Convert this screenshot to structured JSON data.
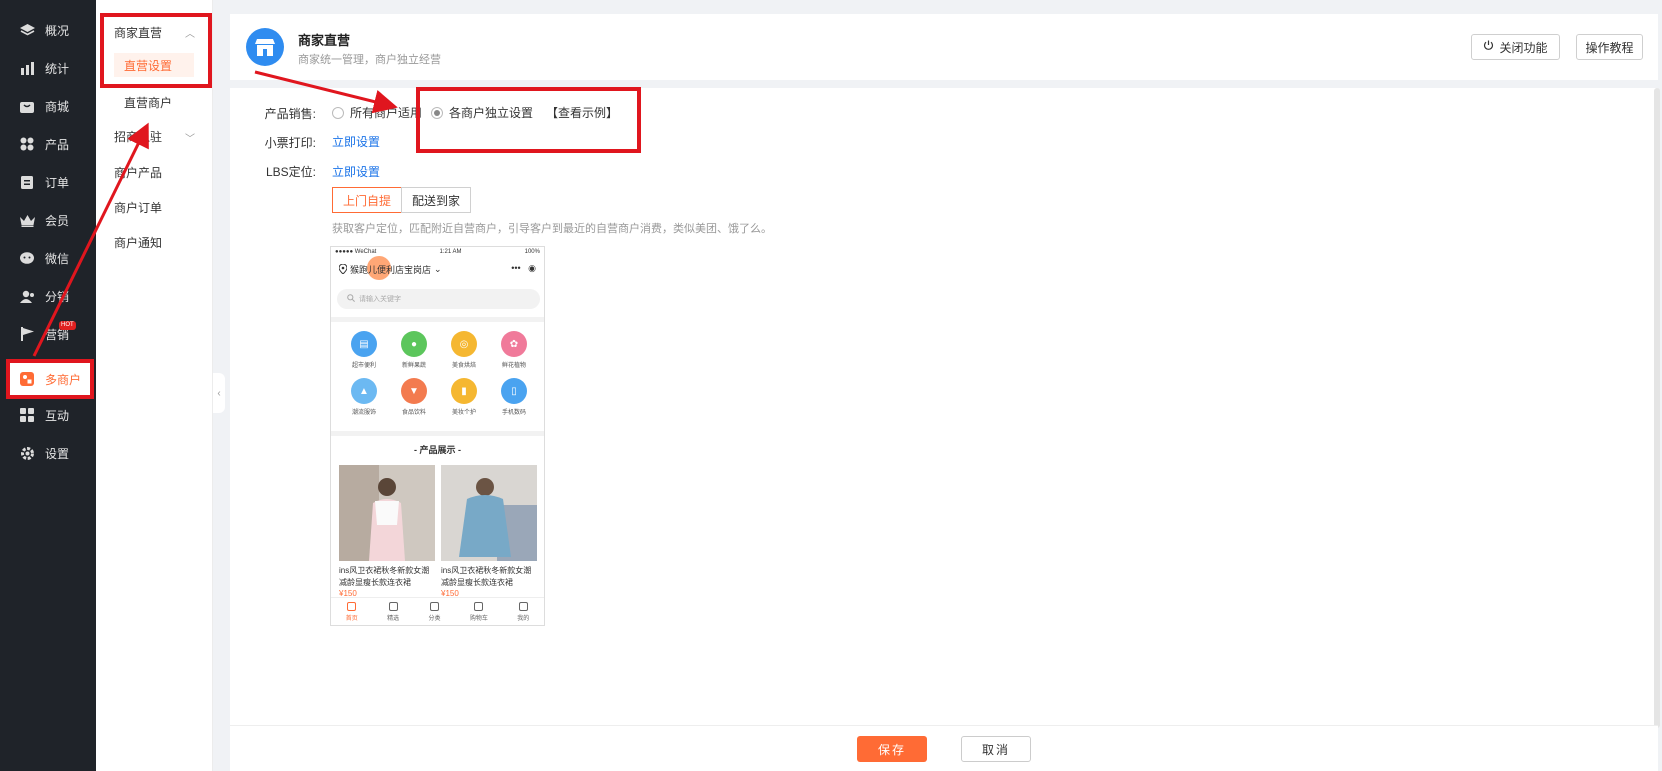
{
  "nav": {
    "items": [
      {
        "label": "概况",
        "icon": "layers-icon"
      },
      {
        "label": "统计",
        "icon": "chart-icon"
      },
      {
        "label": "商城",
        "icon": "shop-icon"
      },
      {
        "label": "产品",
        "icon": "grid-icon"
      },
      {
        "label": "订单",
        "icon": "order-icon"
      },
      {
        "label": "会员",
        "icon": "crown-icon"
      },
      {
        "label": "微信",
        "icon": "wechat-icon"
      },
      {
        "label": "分销",
        "icon": "users-icon"
      },
      {
        "label": "营销",
        "icon": "flag-icon",
        "badge": "HOT"
      },
      {
        "label": "多商户",
        "icon": "merchant-icon"
      },
      {
        "label": "互动",
        "icon": "interact-icon"
      },
      {
        "label": "设置",
        "icon": "gear-icon"
      }
    ],
    "active": "多商户"
  },
  "subnav": {
    "group1": "商家直营",
    "group1_items": [
      "直营设置",
      "直营商户"
    ],
    "group2": "招商入驻",
    "group2_items": [
      "商户产品",
      "商户订单",
      "商户通知"
    ]
  },
  "header": {
    "title": "商家直营",
    "subtitle": "商家统一管理，商户独立经营",
    "close_btn": "关闭功能",
    "tutorial_btn": "操作教程"
  },
  "form": {
    "sales_label": "产品销售:",
    "option_all": "所有商户适用",
    "option_each": "各商户独立设置",
    "view_example": "【查看示例】",
    "print_label": "小票打印:",
    "print_link": "立即设置",
    "lbs_label": "LBS定位:",
    "lbs_link": "立即设置",
    "tab_pickup": "上门自提",
    "tab_delivery": "配送到家",
    "hint": "获取客户定位，匹配附近自营商户，引导客户到最近的自营商户消费，类似美团、饿了么。"
  },
  "phone": {
    "carrier": "●●●●● WeChat",
    "time": "1:21 AM",
    "battery": "100%",
    "location": "猴跑儿便利店宝岗店",
    "search_placeholder": "请输入关键字",
    "categories": [
      {
        "label": "超市便利",
        "color": "#4aa3f0"
      },
      {
        "label": "新鲜果蔬",
        "color": "#5cc65c"
      },
      {
        "label": "美食烘焙",
        "color": "#f5b731"
      },
      {
        "label": "鲜花植物",
        "color": "#f07a9a"
      },
      {
        "label": "潮流服饰",
        "color": "#6cb9f2"
      },
      {
        "label": "食品饮料",
        "color": "#f37b4f"
      },
      {
        "label": "美妆个护",
        "color": "#f5b731"
      },
      {
        "label": "手机数码",
        "color": "#4aa3f0"
      }
    ],
    "section_title": "- 产品展示 -",
    "products": [
      {
        "name": "ins风卫衣裙秋冬新款女潮减龄显瘦长款连衣裙",
        "price": "¥150"
      },
      {
        "name": "ins风卫衣裙秋冬新款女潮减龄显瘦长款连衣裙",
        "price": "¥150"
      }
    ],
    "tabbar": [
      "首页",
      "精选",
      "分类",
      "购物车",
      "我的"
    ]
  },
  "footer": {
    "save": "保存",
    "cancel": "取消"
  },
  "colors": {
    "accent": "#ff6b35",
    "link": "#1a73e8",
    "annotation_red": "#e0161e",
    "nav_bg": "#1f2329"
  }
}
